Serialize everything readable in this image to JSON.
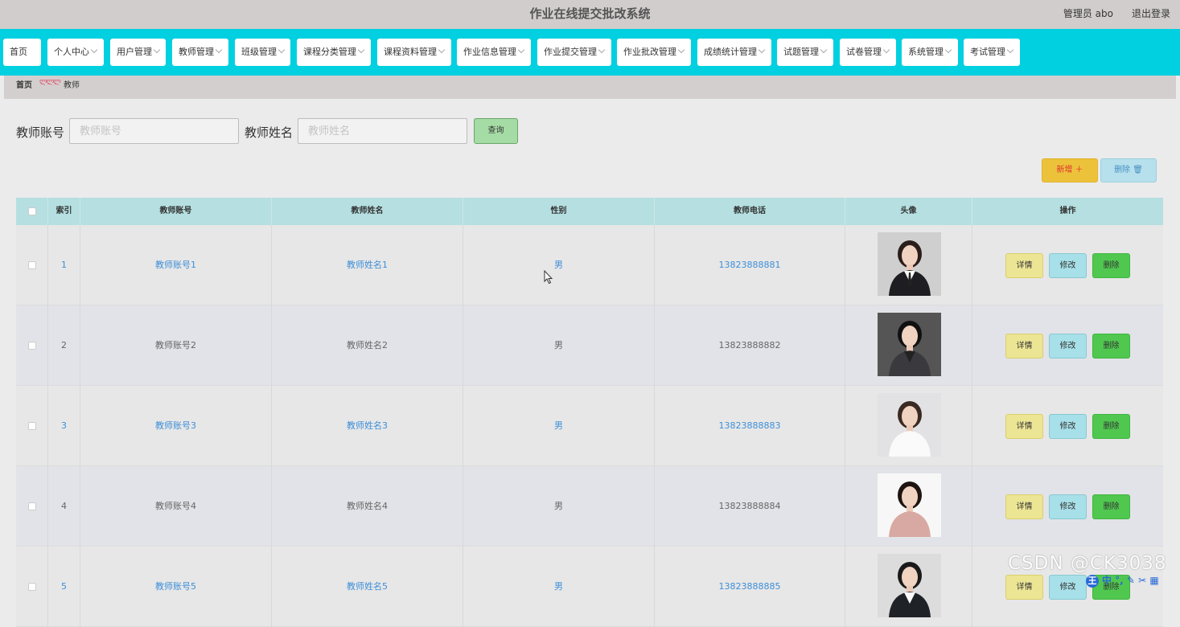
{
  "header": {
    "title": "作业在线提交批改系统",
    "user": "管理员 abo",
    "logout": "退出登录"
  },
  "nav": [
    {
      "label": "首页",
      "dropdown": false
    },
    {
      "label": "个人中心",
      "dropdown": true
    },
    {
      "label": "用户管理",
      "dropdown": true
    },
    {
      "label": "教师管理",
      "dropdown": true
    },
    {
      "label": "班级管理",
      "dropdown": true
    },
    {
      "label": "课程分类管理",
      "dropdown": true
    },
    {
      "label": "课程资料管理",
      "dropdown": true
    },
    {
      "label": "作业信息管理",
      "dropdown": true
    },
    {
      "label": "作业提交管理",
      "dropdown": true
    },
    {
      "label": "作业批改管理",
      "dropdown": true
    },
    {
      "label": "成绩统计管理",
      "dropdown": true
    },
    {
      "label": "试题管理",
      "dropdown": true
    },
    {
      "label": "试卷管理",
      "dropdown": true
    },
    {
      "label": "系统管理",
      "dropdown": true
    },
    {
      "label": "考试管理",
      "dropdown": true
    }
  ],
  "breadcrumb": {
    "home": "首页",
    "separator": "ლლლ",
    "current": "教师"
  },
  "search": {
    "account_label": "教师账号",
    "account_placeholder": "教师账号",
    "name_label": "教师姓名",
    "name_placeholder": "教师姓名",
    "query": "查询"
  },
  "toolbar": {
    "add": "新增 ＋",
    "delete": "删除 🗑"
  },
  "table": {
    "headers": {
      "index": "索引",
      "account": "教师账号",
      "name": "教师姓名",
      "gender": "性别",
      "phone": "教师电话",
      "avatar": "头像",
      "actions": "操作"
    },
    "rows": [
      {
        "index": "1",
        "account": "教师账号1",
        "name": "教师姓名1",
        "gender": "男",
        "phone": "13823888881"
      },
      {
        "index": "2",
        "account": "教师账号2",
        "name": "教师姓名2",
        "gender": "男",
        "phone": "13823888882"
      },
      {
        "index": "3",
        "account": "教师账号3",
        "name": "教师姓名3",
        "gender": "男",
        "phone": "13823888883"
      },
      {
        "index": "4",
        "account": "教师账号4",
        "name": "教师姓名4",
        "gender": "男",
        "phone": "13823888884"
      },
      {
        "index": "5",
        "account": "教师账号5",
        "name": "教师姓名5",
        "gender": "男",
        "phone": "13823888885"
      }
    ],
    "actions": {
      "detail": "详情",
      "edit": "修改",
      "delete": "删除"
    }
  },
  "watermark": "CSDN @CK3038",
  "ime": {
    "badge": "王",
    "text": "中 °, ✎ ✂ ▦"
  },
  "colors": {
    "nav_bg": "#00d0e0",
    "title_bar": "#d2cdcd",
    "link": "#3d8fd8",
    "header_row": "#b5dfe0"
  }
}
